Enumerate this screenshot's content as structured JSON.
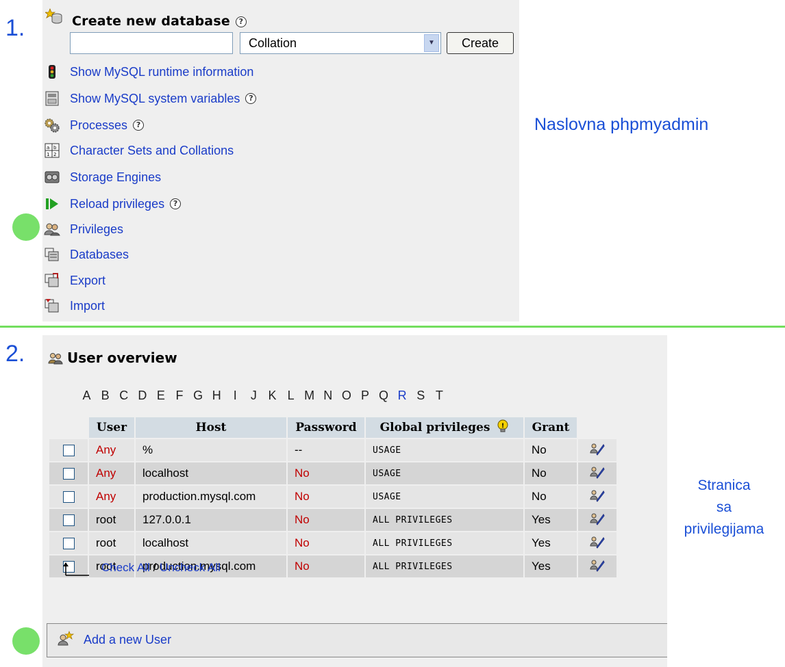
{
  "steps": {
    "one": "1.",
    "two": "2."
  },
  "panel1": {
    "title": "Create new database",
    "create_button": "Create",
    "collation_selected": "Collation",
    "menu": [
      {
        "label": "Show MySQL runtime information",
        "icon": "traffic-light-icon",
        "help": false
      },
      {
        "label": "Show MySQL system variables",
        "icon": "variables-icon",
        "help": true
      },
      {
        "label": "Processes",
        "icon": "gears-icon",
        "help": true
      },
      {
        "label": "Character Sets and Collations",
        "icon": "charset-icon",
        "help": false
      },
      {
        "label": "Storage Engines",
        "icon": "storage-engines-icon",
        "help": false
      },
      {
        "label": "Reload privileges",
        "icon": "reload-icon",
        "help": true
      },
      {
        "label": "Privileges",
        "icon": "privileges-icon",
        "help": false
      },
      {
        "label": "Databases",
        "icon": "databases-icon",
        "help": false
      },
      {
        "label": "Export",
        "icon": "export-icon",
        "help": false
      },
      {
        "label": "Import",
        "icon": "import-icon",
        "help": false
      }
    ]
  },
  "caption1": "Naslovna phpmyadmin",
  "panel2": {
    "title": "User overview",
    "letters": [
      "A",
      "B",
      "C",
      "D",
      "E",
      "F",
      "G",
      "H",
      "I",
      "J",
      "K",
      "L",
      "M",
      "N",
      "O",
      "P",
      "Q",
      "R",
      "S",
      "T"
    ],
    "active_letter": "R",
    "columns": {
      "user": "User",
      "host": "Host",
      "password": "Password",
      "global_privileges": "Global privileges",
      "grant": "Grant"
    },
    "rows": [
      {
        "user": "Any",
        "host": "%",
        "password": "--",
        "privileges": "USAGE",
        "grant": "No"
      },
      {
        "user": "Any",
        "host": "localhost",
        "password": "No",
        "privileges": "USAGE",
        "grant": "No"
      },
      {
        "user": "Any",
        "host": "production.mysql.com",
        "password": "No",
        "privileges": "USAGE",
        "grant": "No"
      },
      {
        "user": "root",
        "host": "127.0.0.1",
        "password": "No",
        "privileges": "ALL PRIVILEGES",
        "grant": "Yes"
      },
      {
        "user": "root",
        "host": "localhost",
        "password": "No",
        "privileges": "ALL PRIVILEGES",
        "grant": "Yes"
      },
      {
        "user": "root",
        "host": "production.mysql.com",
        "password": "No",
        "privileges": "ALL PRIVILEGES",
        "grant": "Yes"
      }
    ],
    "check_all": "Check All",
    "separator": " / ",
    "uncheck_all": "Uncheck All",
    "add_user": "Add a new User"
  },
  "caption2": {
    "line1": "Stranica",
    "line2": "sa",
    "line3": "privilegijama"
  },
  "colors": {
    "link": "#1a3cc8",
    "caption": "#1a4fd6",
    "highlight_dot": "#78e06a",
    "divider": "#73de5e",
    "red_value": "#c00000"
  }
}
